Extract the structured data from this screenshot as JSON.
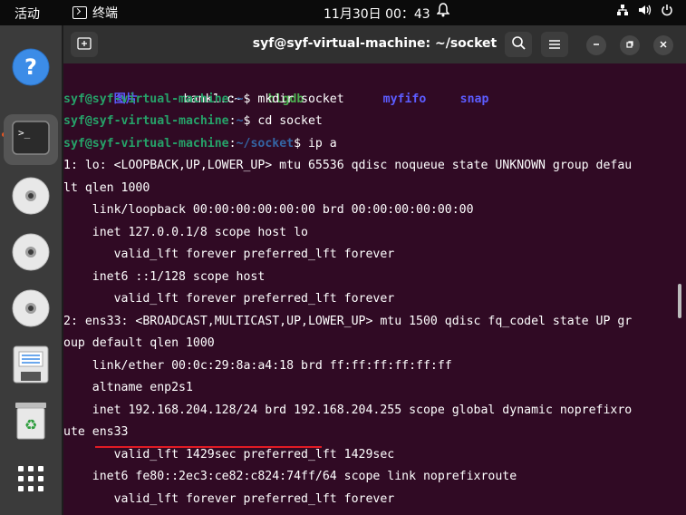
{
  "topbar": {
    "activities": "活动",
    "app_name": "终端",
    "clock": "11月30日 00：43"
  },
  "dock": {
    "items": [
      {
        "name": "help",
        "icon": "help-icon"
      },
      {
        "name": "terminal",
        "icon": "terminal-icon",
        "active": true
      },
      {
        "name": "disc-1",
        "icon": "disc-icon"
      },
      {
        "name": "disc-2",
        "icon": "disc-icon"
      },
      {
        "name": "disc-3",
        "icon": "disc-icon"
      },
      {
        "name": "save",
        "icon": "floppy-icon"
      },
      {
        "name": "trash",
        "icon": "trash-icon"
      },
      {
        "name": "apps",
        "icon": "app-grid-icon"
      }
    ]
  },
  "window": {
    "title": "syf@syf-virtual-machine: ~/socket"
  },
  "terminal": {
    "ls_row": [
      "图片",
      "bank1.c~",
      "hlgdb",
      "myfifo",
      "snap"
    ],
    "lines": [
      {
        "user": "syf@syf-virtual-machine",
        "path": "~",
        "cmd": "$ mkdir socket"
      },
      {
        "user": "syf@syf-virtual-machine",
        "path": "~",
        "cmd": "$ cd socket"
      },
      {
        "user": "syf@syf-virtual-machine",
        "path": "~/socket",
        "cmd": "$ ip a"
      }
    ],
    "output": [
      "1: lo: <LOOPBACK,UP,LOWER_UP> mtu 65536 qdisc noqueue state UNKNOWN group defau",
      "lt qlen 1000",
      "    link/loopback 00:00:00:00:00:00 brd 00:00:00:00:00:00",
      "    inet 127.0.0.1/8 scope host lo",
      "       valid_lft forever preferred_lft forever",
      "    inet6 ::1/128 scope host",
      "       valid_lft forever preferred_lft forever",
      "2: ens33: <BROADCAST,MULTICAST,UP,LOWER_UP> mtu 1500 qdisc fq_codel state UP gr",
      "oup default qlen 1000",
      "    link/ether 00:0c:29:8a:a4:18 brd ff:ff:ff:ff:ff:ff",
      "    altname enp2s1",
      "    inet 192.168.204.128/24 brd 192.168.204.255 scope global dynamic noprefixro",
      "ute ens33",
      "       valid_lft 1429sec preferred_lft 1429sec",
      "    inet6 fe80::2ec3:ce82:c824:74ff/64 scope link noprefixroute",
      "       valid_lft forever preferred_lft forever"
    ]
  },
  "colors": {
    "terminal_bg": "#300a24",
    "prompt_user": "#26a269",
    "prompt_path": "#3465a4",
    "highlight_underline": "#e01b24",
    "dock_bg": "#3b3b3b"
  }
}
